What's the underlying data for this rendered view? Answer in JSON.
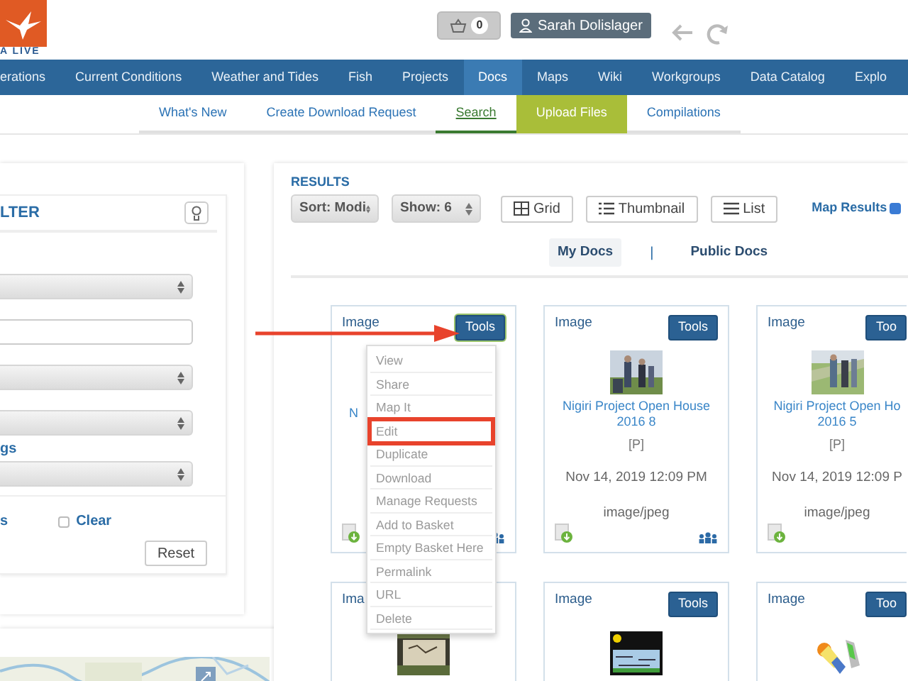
{
  "header": {
    "logo_text": "A LIVE",
    "basket_count": "0",
    "user": "Sarah Dolislager"
  },
  "nav": [
    {
      "label": "erations",
      "selected": false
    },
    {
      "label": "Current Conditions",
      "selected": false
    },
    {
      "label": "Weather and Tides",
      "selected": false
    },
    {
      "label": "Fish",
      "selected": false
    },
    {
      "label": "Projects",
      "selected": false
    },
    {
      "label": "Docs",
      "selected": true
    },
    {
      "label": "Maps",
      "selected": false
    },
    {
      "label": "Wiki",
      "selected": false
    },
    {
      "label": "Workgroups",
      "selected": false
    },
    {
      "label": "Data Catalog",
      "selected": false
    },
    {
      "label": "Explo",
      "selected": false
    }
  ],
  "subnav": [
    {
      "label": "What's New",
      "kind": "link",
      "selected": false
    },
    {
      "label": "Create Download Request",
      "kind": "link",
      "selected": false
    },
    {
      "label": "Search",
      "kind": "link",
      "selected": true
    },
    {
      "label": "Upload Files",
      "kind": "button",
      "selected": false
    },
    {
      "label": "Compilations",
      "kind": "link",
      "selected": false
    }
  ],
  "filter": {
    "title": "LTER",
    "fields": [
      {
        "kind": "select"
      },
      {
        "kind": "input"
      },
      {
        "kind": "select"
      },
      {
        "kind": "select"
      },
      {
        "kind": "select",
        "label": "gs"
      }
    ],
    "options": [
      {
        "kind": "text",
        "label": "s"
      },
      {
        "kind": "checkbox",
        "label": "Clear",
        "checked": false
      }
    ],
    "reset": "Reset"
  },
  "results": {
    "title": "RESULTS",
    "sort": "Sort: Modi",
    "show": "Show: 6",
    "views": [
      "Grid",
      "Thumbnail",
      "List"
    ],
    "map_results": {
      "label": "Map Results",
      "checked": true
    },
    "tabs": [
      {
        "label": "My Docs",
        "selected": true
      },
      {
        "label": "Public Docs",
        "selected": false
      }
    ],
    "separator": "|",
    "cards": [
      {
        "type": "Image",
        "tools": "Tools",
        "menu_open": true,
        "title": "N",
        "download": true,
        "shared": true
      },
      {
        "type": "Image",
        "tools": "Tools",
        "menu_open": false,
        "picture": true,
        "title": "Nigiri Project Open House 2016 8",
        "flag": "[P]",
        "date": "Nov 14, 2019 12:09 PM",
        "mime": "image/jpeg",
        "download": true,
        "shared": true
      },
      {
        "type": "Image",
        "tools": "Too",
        "menu_open": false,
        "picture": true,
        "title": "Nigiri Project Open Ho\n2016 5",
        "flag": "[P]",
        "date": "Nov 14, 2019 12:09 P",
        "mime": "image/jpeg",
        "download": true,
        "shared": false
      },
      {
        "type": "Ima",
        "picture": true
      },
      {
        "type": "Image",
        "tools": "Tools",
        "menu_open": false,
        "picture": true
      },
      {
        "type": "Image",
        "tools": "Too",
        "menu_open": false,
        "picture": true
      }
    ],
    "menu": {
      "items": [
        {
          "label": "View",
          "boxed": false
        },
        {
          "label": "Share",
          "boxed": false
        },
        {
          "label": "Map It",
          "boxed": false
        },
        {
          "label": "Edit",
          "boxed": true
        },
        {
          "label": "Duplicate",
          "boxed": false
        },
        {
          "label": "Download",
          "boxed": false
        },
        {
          "label": "Manage Requests",
          "boxed": false
        },
        {
          "label": "Add to Basket",
          "boxed": false
        },
        {
          "label": "Empty Basket Here",
          "boxed": false
        },
        {
          "label": "Permalink",
          "boxed": false
        },
        {
          "label": "URL",
          "boxed": false
        },
        {
          "label": "Delete",
          "boxed": false
        }
      ]
    }
  }
}
